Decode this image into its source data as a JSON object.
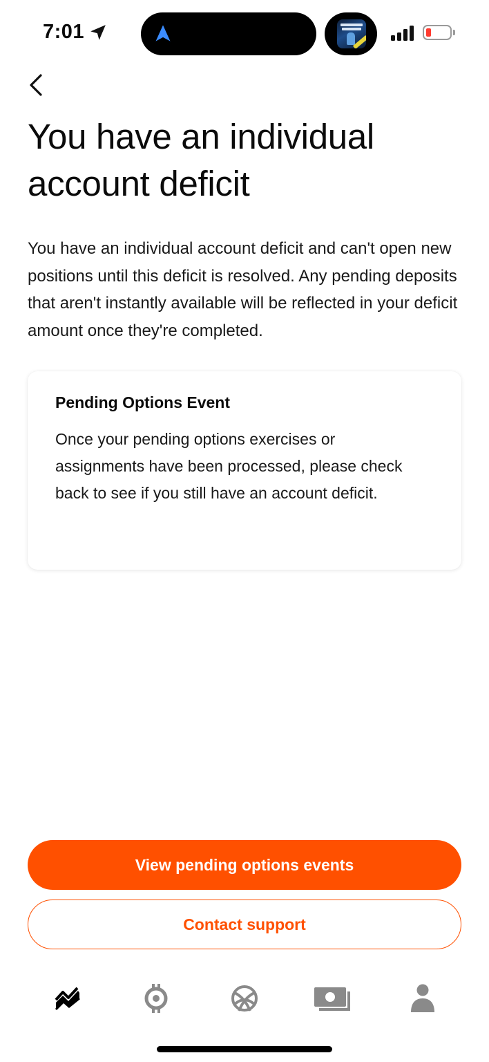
{
  "status_bar": {
    "time": "7:01",
    "icons": [
      "location-arrow-icon",
      "navigation-app-icon",
      "now-playing-album-art",
      "signal-bars-icon",
      "battery-low-icon"
    ],
    "battery_color": "#ff3b30"
  },
  "header": {
    "back_icon": "chevron-left-icon",
    "title": "You have an individual account deficit"
  },
  "main": {
    "description": "You have an individual account deficit and can't open new positions until this deficit is resolved. Any pending deposits that aren't instantly available will be reflected in your deficit amount once they're completed.",
    "card": {
      "title": "Pending Options Event",
      "body": "Once your pending options exercises or assignments have been processed, please check back to see if you still have an account deficit."
    }
  },
  "actions": {
    "primary_label": "View pending options events",
    "secondary_label": "Contact support",
    "accent_color": "#ff5000"
  },
  "tab_bar": {
    "items": [
      {
        "icon": "investing-chart-icon",
        "active": true
      },
      {
        "icon": "crypto-icon",
        "active": false
      },
      {
        "icon": "network-icon",
        "active": false
      },
      {
        "icon": "cash-card-icon",
        "active": false
      },
      {
        "icon": "account-person-icon",
        "active": false
      }
    ],
    "active_color": "#000000",
    "inactive_color": "#8a8a8a"
  }
}
